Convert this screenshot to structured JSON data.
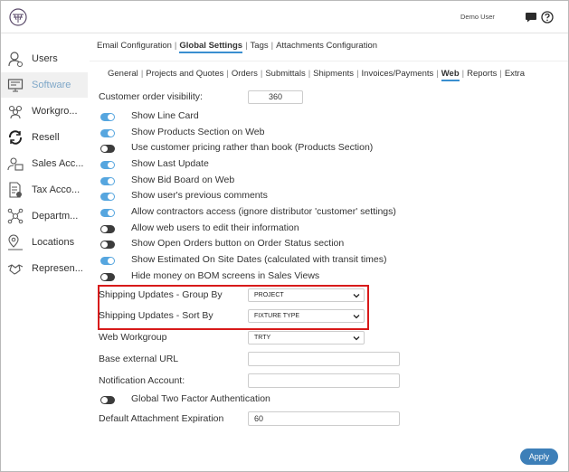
{
  "header": {
    "user_name": "Demo User"
  },
  "sidebar": {
    "items": [
      {
        "label": "Users",
        "icon": "user-icon"
      },
      {
        "label": "Software",
        "icon": "monitor-icon",
        "active": true
      },
      {
        "label": "Workgro...",
        "icon": "group-icon"
      },
      {
        "label": "Resell",
        "icon": "resell-icon"
      },
      {
        "label": "Sales Acc...",
        "icon": "sales-icon"
      },
      {
        "label": "Tax Acco...",
        "icon": "tax-icon"
      },
      {
        "label": "Departm...",
        "icon": "department-icon"
      },
      {
        "label": "Locations",
        "icon": "location-icon"
      },
      {
        "label": "Represen...",
        "icon": "handshake-icon"
      }
    ]
  },
  "subnav": {
    "items": [
      "Email Configuration",
      "Global Settings",
      "Tags",
      "Attachments Configuration"
    ],
    "active": "Global Settings"
  },
  "tabs": {
    "items": [
      "General",
      "Projects and Quotes",
      "Orders",
      "Submittals",
      "Shipments",
      "Invoices/Payments",
      "Web",
      "Reports",
      "Extra"
    ],
    "active": "Web"
  },
  "settings": {
    "customer_order_visibility_label": "Customer order visibility:",
    "customer_order_visibility_value": "360",
    "toggles": [
      {
        "label": "Show Line Card",
        "on": true
      },
      {
        "label": "Show Products Section on Web",
        "on": true
      },
      {
        "label": "Use customer pricing rather than book (Products Section)",
        "on": false
      },
      {
        "label": "Show Last Update",
        "on": true
      },
      {
        "label": "Show Bid Board on Web",
        "on": true
      },
      {
        "label": "Show user's previous comments",
        "on": true
      },
      {
        "label": "Allow contractors access (ignore distributor 'customer' settings)",
        "on": true
      },
      {
        "label": "Allow web users to edit their information",
        "on": false
      },
      {
        "label": "Show Open Orders button on Order Status section",
        "on": false
      },
      {
        "label": "Show Estimated On Site Dates (calculated with transit times)",
        "on": true
      },
      {
        "label": "Hide money on BOM screens in Sales Views",
        "on": false
      }
    ],
    "group_by_label": "Shipping Updates - Group By",
    "group_by_value": "PROJECT",
    "sort_by_label": "Shipping Updates - Sort By",
    "sort_by_value": "FIXTURE TYPE",
    "web_workgroup_label": "Web Workgroup",
    "web_workgroup_value": "TRTY",
    "base_url_label": "Base external URL",
    "base_url_value": "",
    "notification_label": "Notification Account:",
    "notification_value": "",
    "two_factor_label": "Global Two Factor Authentication",
    "two_factor_on": false,
    "attachment_expiration_label": "Default Attachment Expiration",
    "attachment_expiration_value": "60"
  },
  "actions": {
    "apply_label": "Apply"
  },
  "colors": {
    "accent": "#3a8fd0",
    "toggle_on": "#56a6df",
    "toggle_off": "#3c3c3c",
    "highlight": "#d81a1a",
    "apply": "#3d7fb8"
  }
}
